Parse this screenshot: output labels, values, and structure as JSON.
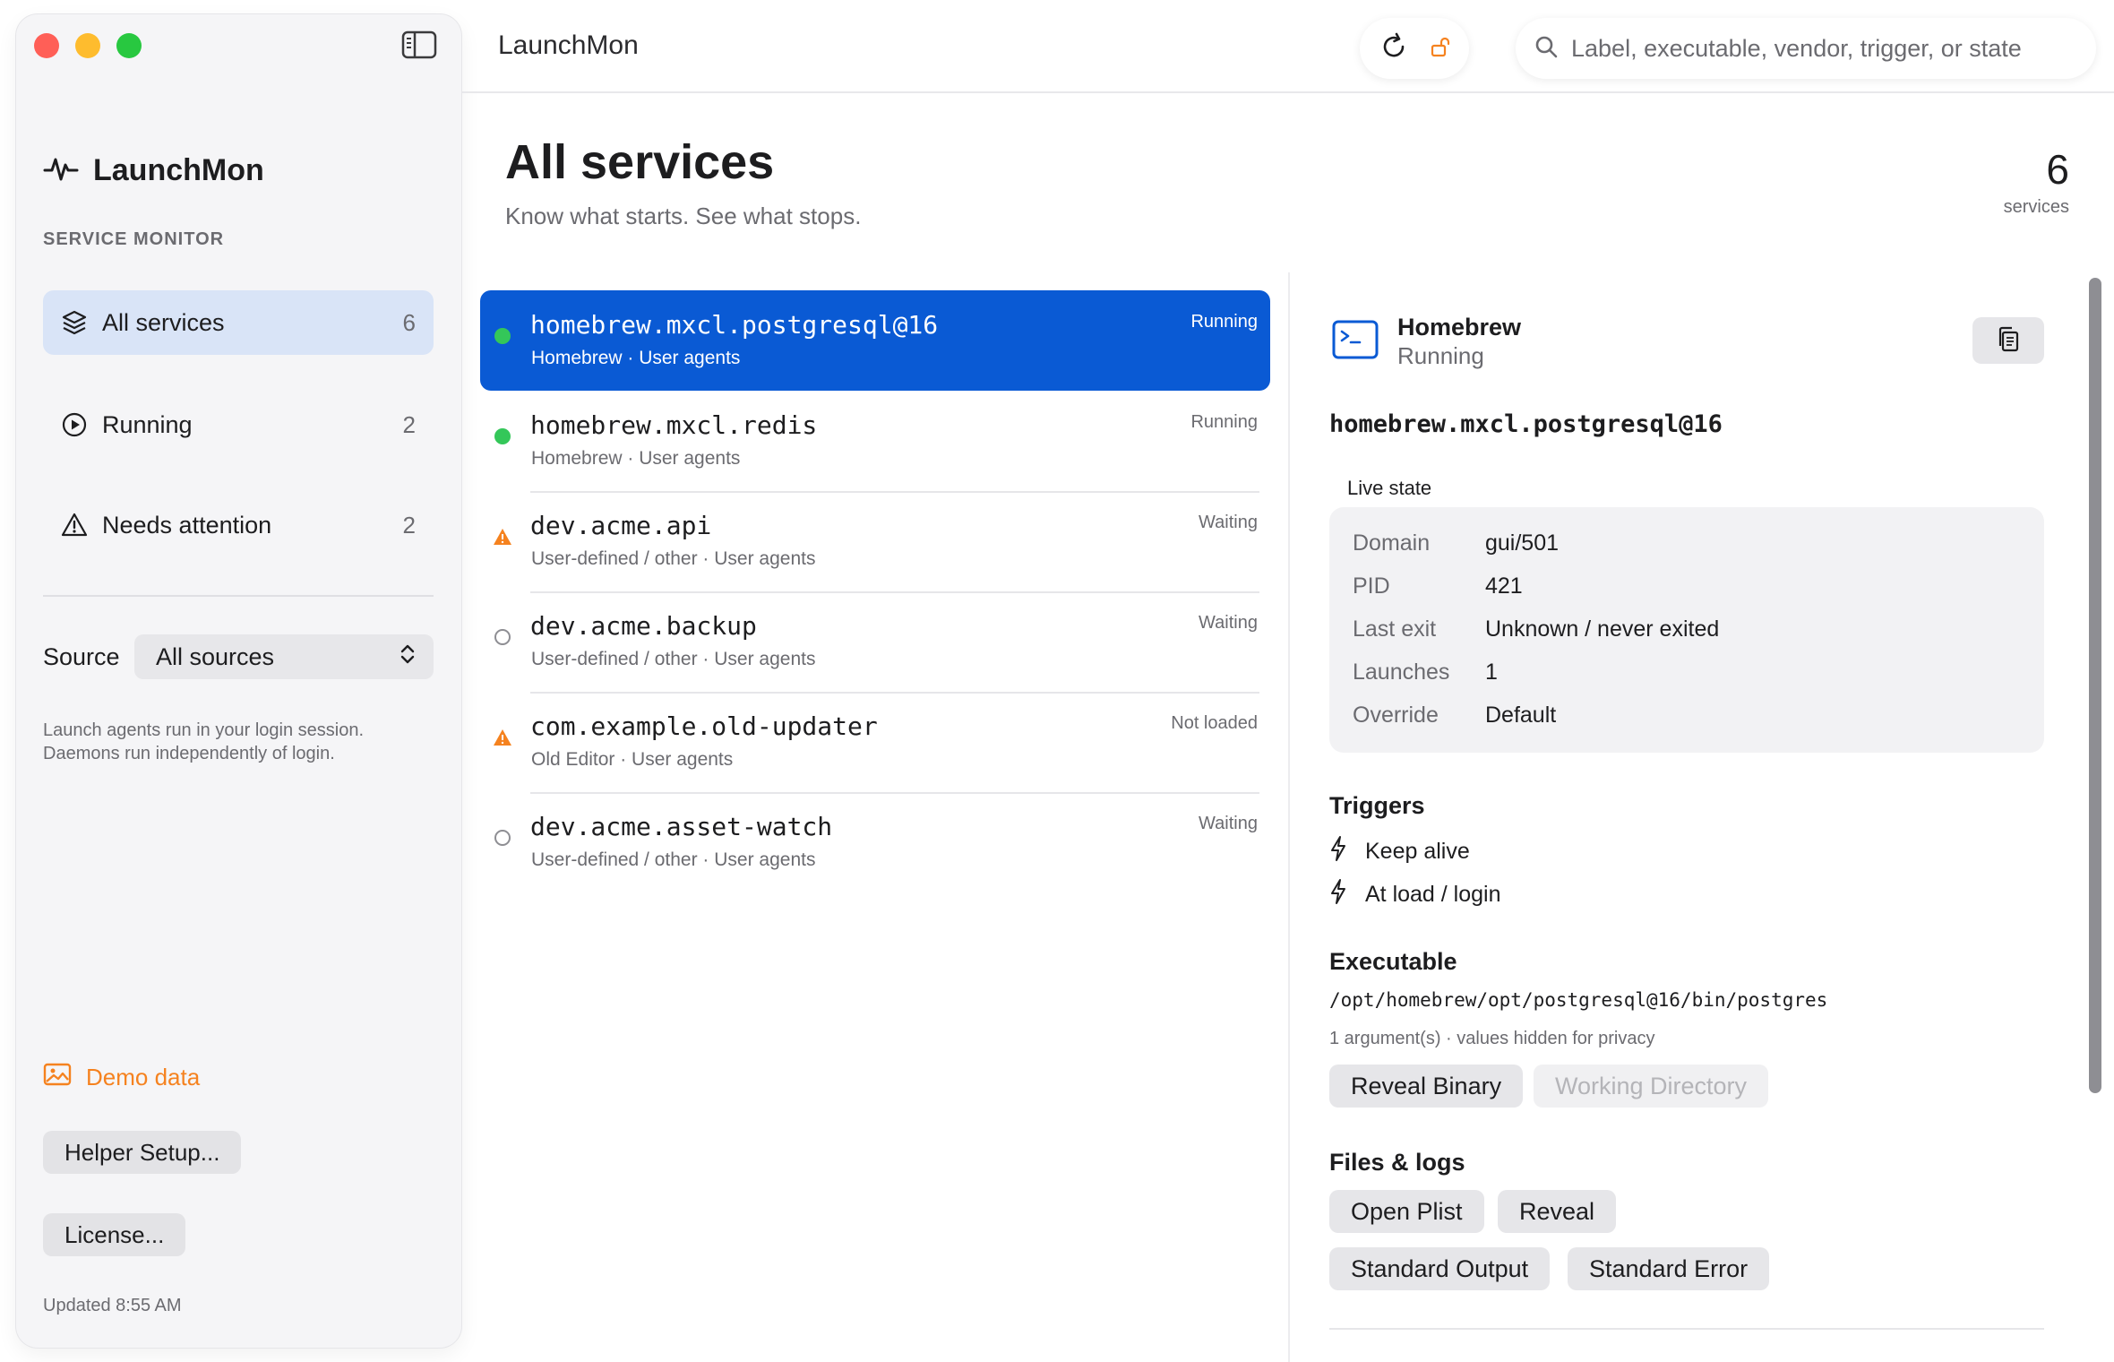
{
  "app": {
    "title": "LaunchMon"
  },
  "sidebar": {
    "brand": "LaunchMon",
    "caption": "SERVICE MONITOR",
    "nav": [
      {
        "label": "All services",
        "count": "6",
        "icon": "layers-icon"
      },
      {
        "label": "Running",
        "count": "2",
        "icon": "play-circle-icon"
      },
      {
        "label": "Needs attention",
        "count": "2",
        "icon": "warning-triangle-icon"
      }
    ],
    "source_label": "Source",
    "source_value": "All sources",
    "note": "Launch agents run in your login session. Daemons run independently of login.",
    "demo_label": "Demo data",
    "helper_button": "Helper Setup...",
    "license_button": "License...",
    "updated": "Updated 8:55 AM"
  },
  "search": {
    "placeholder": "Label, executable, vendor, trigger, or state"
  },
  "main": {
    "title": "All services",
    "subtitle": "Know what starts. See what stops.",
    "count": "6",
    "count_label": "services"
  },
  "services": [
    {
      "name": "homebrew.mxcl.postgresql@16",
      "sub": "Homebrew · User agents",
      "state": "Running",
      "status": "running"
    },
    {
      "name": "homebrew.mxcl.redis",
      "sub": "Homebrew · User agents",
      "state": "Running",
      "status": "running"
    },
    {
      "name": "dev.acme.api",
      "sub": "User-defined / other · User agents",
      "state": "Waiting",
      "status": "warning"
    },
    {
      "name": "dev.acme.backup",
      "sub": "User-defined / other · User agents",
      "state": "Waiting",
      "status": "idle"
    },
    {
      "name": "com.example.old-updater",
      "sub": "Old Editor · User agents",
      "state": "Not loaded",
      "status": "warning"
    },
    {
      "name": "dev.acme.asset-watch",
      "sub": "User-defined / other · User agents",
      "state": "Waiting",
      "status": "idle"
    }
  ],
  "detail": {
    "vendor": "Homebrew",
    "status": "Running",
    "label": "homebrew.mxcl.postgresql@16",
    "live_state_caption": "Live state",
    "live_state": [
      {
        "key": "Domain",
        "value": "gui/501"
      },
      {
        "key": "PID",
        "value": "421"
      },
      {
        "key": "Last exit",
        "value": "Unknown / never exited"
      },
      {
        "key": "Launches",
        "value": "1"
      },
      {
        "key": "Override",
        "value": "Default"
      }
    ],
    "triggers_heading": "Triggers",
    "triggers": [
      "Keep alive",
      "At load / login"
    ],
    "executable_heading": "Executable",
    "executable_path": "/opt/homebrew/opt/postgresql@16/bin/postgres",
    "executable_note": "1 argument(s) · values hidden for privacy",
    "reveal_binary": "Reveal Binary",
    "working_directory": "Working Directory",
    "files_heading": "Files & logs",
    "open_plist": "Open Plist",
    "reveal": "Reveal",
    "standard_output": "Standard Output",
    "standard_error": "Standard Error"
  },
  "colors": {
    "accent": "#0a5ad4",
    "running": "#34c759",
    "warning": "#f5821f",
    "demo": "#f5821f"
  }
}
